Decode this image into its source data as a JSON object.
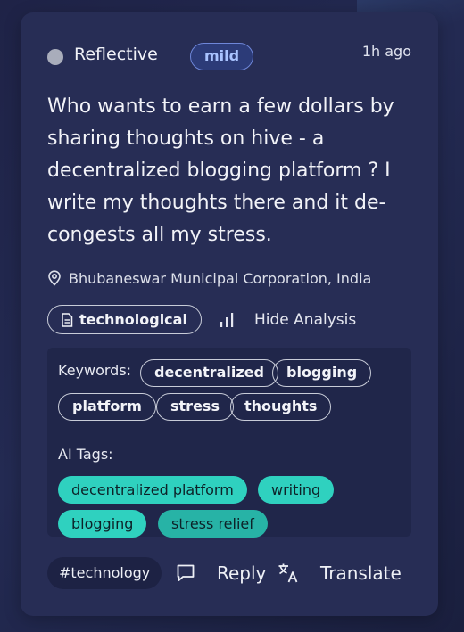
{
  "post": {
    "mood": "Reflective",
    "severity": "mild",
    "time_ago": "1h ago",
    "text": "Who wants to earn a few dollars by sharing thoughts on hive - a decentralized blogging platform ? I write my thoughts there and it de-congests all my stress.",
    "location": "Bhubaneswar Municipal Corporation, India",
    "category": "technological",
    "hide_analysis_label": "Hide Analysis"
  },
  "analysis": {
    "keywords_label": "Keywords:",
    "keywords": [
      "decentralized",
      "blogging",
      "platform",
      "stress",
      "thoughts"
    ],
    "ai_tags_label": "AI Tags:",
    "ai_tags": [
      "decentralized platform",
      "writing",
      "blogging",
      "stress relief"
    ]
  },
  "footer": {
    "hashtag": "#technology",
    "reply_label": "Reply",
    "translate_label": "Translate"
  },
  "icons": {
    "mood": "circle-dot-icon",
    "location": "map-pin-icon",
    "category": "document-icon",
    "analysis": "bar-chart-icon",
    "reply": "chat-bubble-icon",
    "translate": "translate-icon"
  },
  "colors": {
    "card": "#272d55",
    "severity_badge": "#2c3b78",
    "ai_tag": "#2fd1bf",
    "ai_tag_dim": "#27b3a6"
  }
}
